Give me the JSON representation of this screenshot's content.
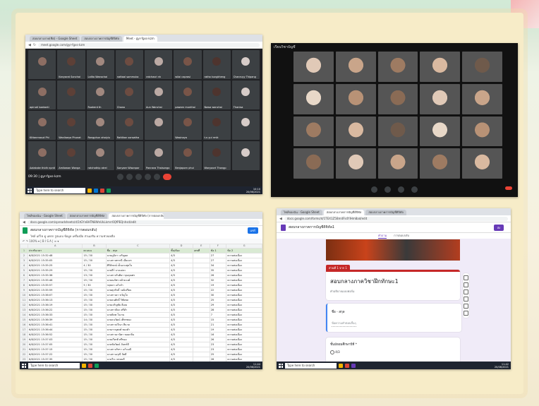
{
  "meet_shot": {
    "tabs": [
      "สอบกลางภาค(ชีต) - Google Sheet",
      "สอบกลางภาคการบัญชีดิจิทัล",
      "Meet - gyr-fgxs-kzm"
    ],
    "url": "meet.google.com/gyr-fgxs-kzm",
    "participants": [
      "",
      "Kanyarat Sonchai",
      "Lalita Waeochai",
      "nattaal sommuka",
      "ratchasri nh",
      "wilai caprasi",
      "ratha kungkheng",
      "Chanruyy Thipang",
      "apirudi kaatanti",
      "",
      "Ruakerd th",
      "Chaaa",
      "Aun Wanchai",
      "pawarn munthai",
      "Nawa wanchai",
      "Thanisa",
      "Kittanmasut Phi",
      "Wanliaeya Phunat",
      "Rongphun ahoiyiu",
      "Rattikan sonsatha",
      "",
      "Wasinaya",
      "t.n.yui rmik",
      "",
      "Aalakake thidh npnti",
      "Amilawan Wonga",
      "ratchathip atrei",
      "Sonyaer Wisanpor",
      "Pannara Thaisongo",
      "Benjaporn phui",
      "Wanyaort Thongp",
      ""
    ],
    "meeting_time": "09:30",
    "meeting_code": "gyr-fgxs-kzm",
    "search_placeholder": "Type here to search",
    "clock": "10:10\n20/06/2021"
  },
  "dark_grid": {
    "top_label": "เรียนวิชาบัญชี",
    "participants": [
      "",
      "",
      "",
      "",
      "",
      "",
      "",
      "",
      "",
      "",
      "",
      "",
      "",
      "",
      "",
      "",
      "",
      "",
      "",
      ""
    ]
  },
  "sheet_shot": {
    "tabs": [
      "ไฟล์ของฉัน - Google Sheet",
      "สอบกลางภาคการบัญชีดิจิทัล",
      "สอบกลางภาคการบัญชีดิจิทัล (การตอบกลับ)"
    ],
    "url": "docs.google.com/spreadsheets/d/1tGYn8HTN8WnUkLkmrr0QfPEQnhsd/edit",
    "title": "สอบกลางภาคการบัญชีดิจิทัล (การตอบกลับ)",
    "menus": "ไฟล์ แก้ไข ดู แทรก รูปแบบ ข้อมูล เครื่องมือ ส่วนเสริม ความช่วยเหลือ",
    "share_label": "แชร์",
    "columns": [
      "",
      "A",
      "B",
      "C",
      "D",
      "E",
      "F",
      "G"
    ],
    "header": [
      "ประทับเวลา",
      "คะแนน",
      "ชื่อ - สกุล",
      "ชั้น/ห้อง",
      "เลขที่",
      "ข้อ 1",
      "ข้อ 2"
    ],
    "rows": [
      [
        "6/8/2021 15:32:48",
        "15 / 30",
        "นายภูมิภา เจริญผล",
        "4/3",
        "",
        "27",
        "ความต่อเนื่อง"
      ],
      [
        "6/8/2021 15:35:05",
        "15 / 30",
        "นางสาวพรรณี เอี่ยมจร",
        "4/3",
        "",
        "27",
        "ความต่อเนื่อง"
      ],
      [
        "6/8/2021 15:35:25",
        "4 / 30",
        "ศิริลักษณ์ เย็นแรงสุดใจ",
        "4/3",
        "",
        "34",
        "ความต่อเนื่อง"
      ],
      [
        "6/8/2021 15:35:29",
        "15 / 30",
        "นายธีร์ บางแม่ละ",
        "4/3",
        "",
        "35",
        "ความต่อเนื่อง"
      ],
      [
        "6/8/2021 15:35:36",
        "13 / 30",
        "นางสาวกันติยา ขุนคุณพร",
        "4/3",
        "",
        "26",
        "ความต่อเนื่อง"
      ],
      [
        "6/8/2021 15:35:46",
        "15 / 30",
        "นายณภัทร คล้ายวงศ์",
        "4/3",
        "",
        "32",
        "ความต่อเนื่อง"
      ],
      [
        "6/8/2021 15:35:57",
        "5 / 30",
        "กฤษดา แก้วดำ",
        "4/3",
        "",
        "19",
        "ความต่อเนื่อง"
      ],
      [
        "6/8/2021 15:35:59",
        "15 / 30",
        "นายศุภกิจธิ์ วงศ์เปรียบ",
        "4/3",
        "",
        "22",
        "ความต่อเนื่อง"
      ],
      [
        "6/8/2021 15:36:07",
        "15 / 30",
        "นางสาวดา ขวัญใจ",
        "4/3",
        "",
        "30",
        "ความต่อเนื่อง"
      ],
      [
        "6/8/2021 15:36:13",
        "15 / 30",
        "นายธนศักดิ์ วิชัยพล",
        "4/3",
        "",
        "25",
        "ความต่อเนื่อง"
      ],
      [
        "6/8/2021 15:36:19",
        "15 / 30",
        "นายเจริญชัย ดีเลย",
        "4/3",
        "",
        "29",
        "ความต่อเนื่อง"
      ],
      [
        "6/8/2021 15:36:22",
        "15 / 30",
        "นางสาวปิยะ ศรีคำ",
        "4/3",
        "",
        "28",
        "ความต่อเนื่อง"
      ],
      [
        "6/8/2021 15:36:33",
        "15 / 30",
        "นายพิภพ ใจงาม",
        "4/3",
        "",
        "7",
        "ความต่อเนื่อง"
      ],
      [
        "6/8/2021 15:36:39",
        "14 / 30",
        "นายธนวัฒน์ เพ็ชรทอง",
        "4/3",
        "",
        "15",
        "ความต่อเนื่อง"
      ],
      [
        "6/8/2021 15:36:41",
        "15 / 30",
        "นางสาวปวีณา สีนาค",
        "4/3",
        "",
        "21",
        "ความต่อเนื่อง"
      ],
      [
        "6/8/2021 15:36:44",
        "15 / 30",
        "นายภาณุพงศ์ ทองคำ",
        "4/3",
        "",
        "19",
        "ความต่อเนื่อง"
      ],
      [
        "6/8/2021 15:36:52",
        "15 / 30",
        "นางสาวมานิตา หอมกลิ่น",
        "4/3",
        "",
        "16",
        "ความต่อเนื่อง"
      ],
      [
        "6/8/2021 15:37:03",
        "15 / 30",
        "นายเกียรติ ศรีทอง",
        "4/3",
        "",
        "26",
        "ความต่อเนื่อง"
      ],
      [
        "6/8/2021 15:37:05",
        "15 / 30",
        "นายชัยวัฒน์ จันทร์ดี",
        "4/3",
        "",
        "23",
        "ความต่อเนื่อง"
      ],
      [
        "6/8/2021 15:37:15",
        "15 / 30",
        "นางสาวภัทรา แก้วมณี",
        "4/3",
        "",
        "23",
        "ความต่อเนื่อง"
      ],
      [
        "6/8/2021 15:37:22",
        "15 / 30",
        "นางสาวอรุณี จิตดี",
        "4/3",
        "",
        "25",
        "ความต่อเนื่อง"
      ],
      [
        "6/8/2021 15:37:35",
        "15 / 30",
        "นายวีระ พรหมดี",
        "4/3",
        "",
        "28",
        "ความต่อเนื่อง"
      ],
      [
        "6/8/2021 15:37:47",
        "14 / 30",
        "นายสมชาย ศรีสุข",
        "4/3",
        "",
        "20",
        "ความต่อเนื่อง"
      ],
      [
        "6/8/2021 15:38:02",
        "15 / 30",
        "นางสาวกมลา ใจดี",
        "4/3",
        "",
        "22",
        "ความต่อเนื่อง"
      ],
      [
        "6/8/2021 15:38:11",
        "15 / 30",
        "นายธนากร สุขใจ",
        "4/3",
        "",
        "24",
        "ความต่อเนื่อง"
      ],
      [
        "6/8/2021 15:38:25",
        "15 / 30",
        "นางสาวพิมพ์ชนก บุญมา",
        "4/3",
        "",
        "27",
        "ความต่อเนื่อง"
      ]
    ],
    "search_placeholder": "Type here to search",
    "clock": "11:44\n20/06/2021"
  },
  "form_shot": {
    "tabs": [
      "ไฟล์ของฉัน - Google Sheet",
      "สอบกลางภาคการบัญชีดิจิทัล",
      "สอบกลางภาคการบัญชีดิจิทัล"
    ],
    "url": "docs.google.com/forms/d/1TEX1Z5Bm4Fk4YIHm8ad/edit",
    "title": "สอบกลางภาคการบัญชีดิจิทัล1",
    "send_label": "ส่ง",
    "tab_questions": "คำถาม",
    "tab_responses": "การตอบกลับ",
    "section_label": "ส่วนที่ 1 จาก 1",
    "form_title": "สอบกลางภาควิชาฝึกทักษะ1",
    "form_desc": "คำอธิบายแบบฟอร์ม",
    "q1_label": "ชื่อ - สกุล",
    "q1_hint": "ข้อความคำตอบสั้นๆ",
    "q2_label": "ชั้นมัธยมศึกษาปีที่ *",
    "q2_option": "4/3",
    "search_placeholder": "Type here to search",
    "clock": "11:42\n20/06/2021"
  }
}
